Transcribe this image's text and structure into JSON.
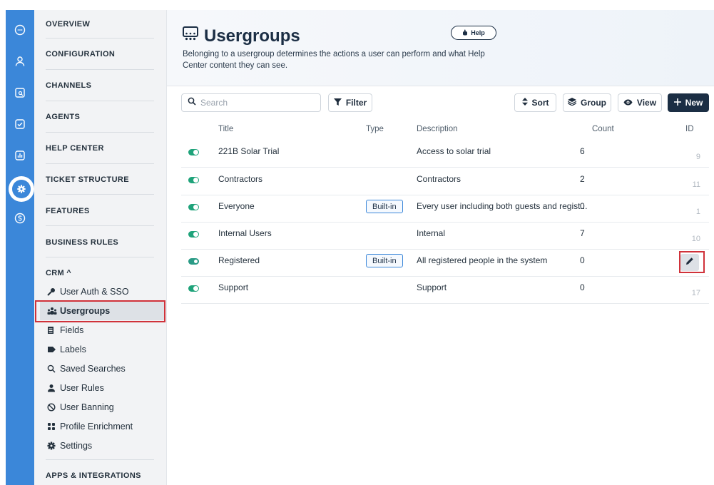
{
  "sidebar": {
    "sections": [
      {
        "label": "OVERVIEW"
      },
      {
        "label": "CONFIGURATION"
      },
      {
        "label": "CHANNELS"
      },
      {
        "label": "AGENTS"
      },
      {
        "label": "HELP CENTER"
      },
      {
        "label": "TICKET STRUCTURE"
      },
      {
        "label": "FEATURES"
      },
      {
        "label": "BUSINESS RULES"
      }
    ],
    "crm_label": "CRM ^",
    "crm_items": [
      {
        "label": "User Auth & SSO",
        "icon": "key-icon"
      },
      {
        "label": "Usergroups",
        "icon": "usergroups-icon"
      },
      {
        "label": "Fields",
        "icon": "fields-icon"
      },
      {
        "label": "Labels",
        "icon": "tag-icon"
      },
      {
        "label": "Saved Searches",
        "icon": "search-icon"
      },
      {
        "label": "User Rules",
        "icon": "user-icon"
      },
      {
        "label": "User Banning",
        "icon": "ban-icon"
      },
      {
        "label": "Profile Enrichment",
        "icon": "grid-icon"
      },
      {
        "label": "Settings",
        "icon": "gear-icon"
      }
    ],
    "bottom_label": "APPS & INTEGRATIONS"
  },
  "header": {
    "title": "Usergroups",
    "help_label": "Help",
    "description": "Belonging to a usergroup determines the actions a user can perform and what Help Center content they can see."
  },
  "toolbar": {
    "search_placeholder": "Search",
    "filter_label": "Filter",
    "sort_label": "Sort",
    "group_label": "Group",
    "view_label": "View",
    "new_label": "New"
  },
  "table": {
    "columns": {
      "title": "Title",
      "type": "Type",
      "description": "Description",
      "count": "Count",
      "id": "ID"
    },
    "rows": [
      {
        "title": "221B Solar Trial",
        "type": "",
        "description": "Access to solar trial",
        "count": "6",
        "id": "9"
      },
      {
        "title": "Contractors",
        "type": "",
        "description": "Contractors",
        "count": "2",
        "id": "11"
      },
      {
        "title": "Everyone",
        "type": "Built-in",
        "description": "Every user including both guests and regist...",
        "count": "0",
        "id": "1"
      },
      {
        "title": "Internal Users",
        "type": "",
        "description": "Internal",
        "count": "7",
        "id": "10"
      },
      {
        "title": "Registered",
        "type": "Built-in",
        "description": "All registered people in the system",
        "count": "0",
        "id": ""
      },
      {
        "title": "Support",
        "type": "",
        "description": "Support",
        "count": "0",
        "id": "17"
      }
    ]
  },
  "colors": {
    "rail": "#3b87d9",
    "primary": "#1b2e44",
    "toggle_on": "#1fa37a",
    "highlight": "#d0323a"
  }
}
